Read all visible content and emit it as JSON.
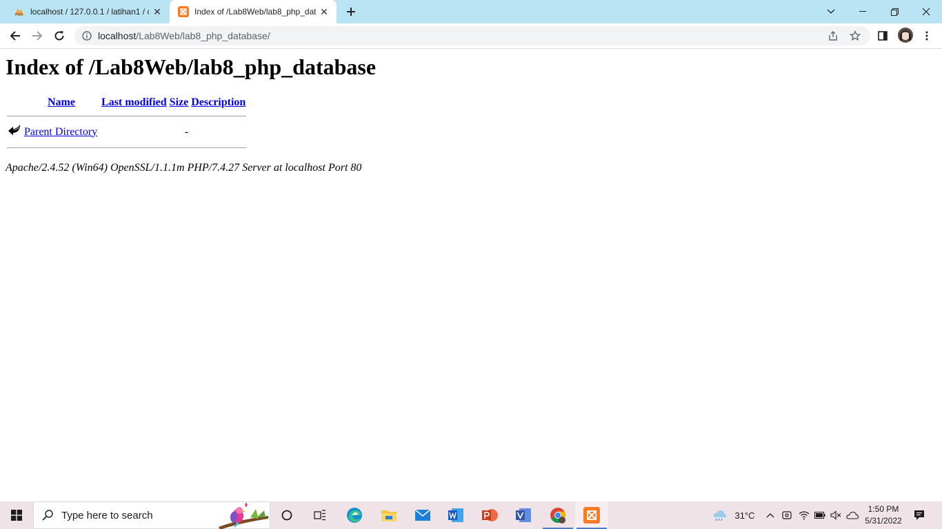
{
  "browser": {
    "tabs": [
      {
        "title": "localhost / 127.0.0.1 / latihan1 / c",
        "favicon": "phpmyadmin-icon",
        "active": false
      },
      {
        "title": "Index of /Lab8Web/lab8_php_dat",
        "favicon": "xampp-icon",
        "active": true
      }
    ],
    "url_host": "localhost",
    "url_path": "/Lab8Web/lab8_php_database/"
  },
  "page": {
    "heading": "Index of /Lab8Web/lab8_php_database",
    "columns": {
      "name": "Name",
      "last_modified": "Last modified",
      "size": "Size",
      "description": "Description"
    },
    "rows": [
      {
        "icon": "back-arrow-icon",
        "name": "Parent Directory",
        "last_modified": "",
        "size": "-",
        "description": ""
      }
    ],
    "address": "Apache/2.4.52 (Win64) OpenSSL/1.1.1m PHP/7.4.27 Server at localhost Port 80"
  },
  "taskbar": {
    "search_placeholder": "Type here to search",
    "apps": [
      "cortana-icon",
      "task-view-icon",
      "edge-icon",
      "file-explorer-icon",
      "mail-icon",
      "word-icon",
      "powerpoint-icon",
      "visio-icon",
      "chrome-icon",
      "xampp-icon"
    ],
    "weather": "31°C",
    "time": "1:50 PM",
    "date": "5/31/2022"
  },
  "colors": {
    "tabstrip": "#b9e4f4",
    "link": "#0000ee",
    "taskbar": "#f0e3e7"
  }
}
